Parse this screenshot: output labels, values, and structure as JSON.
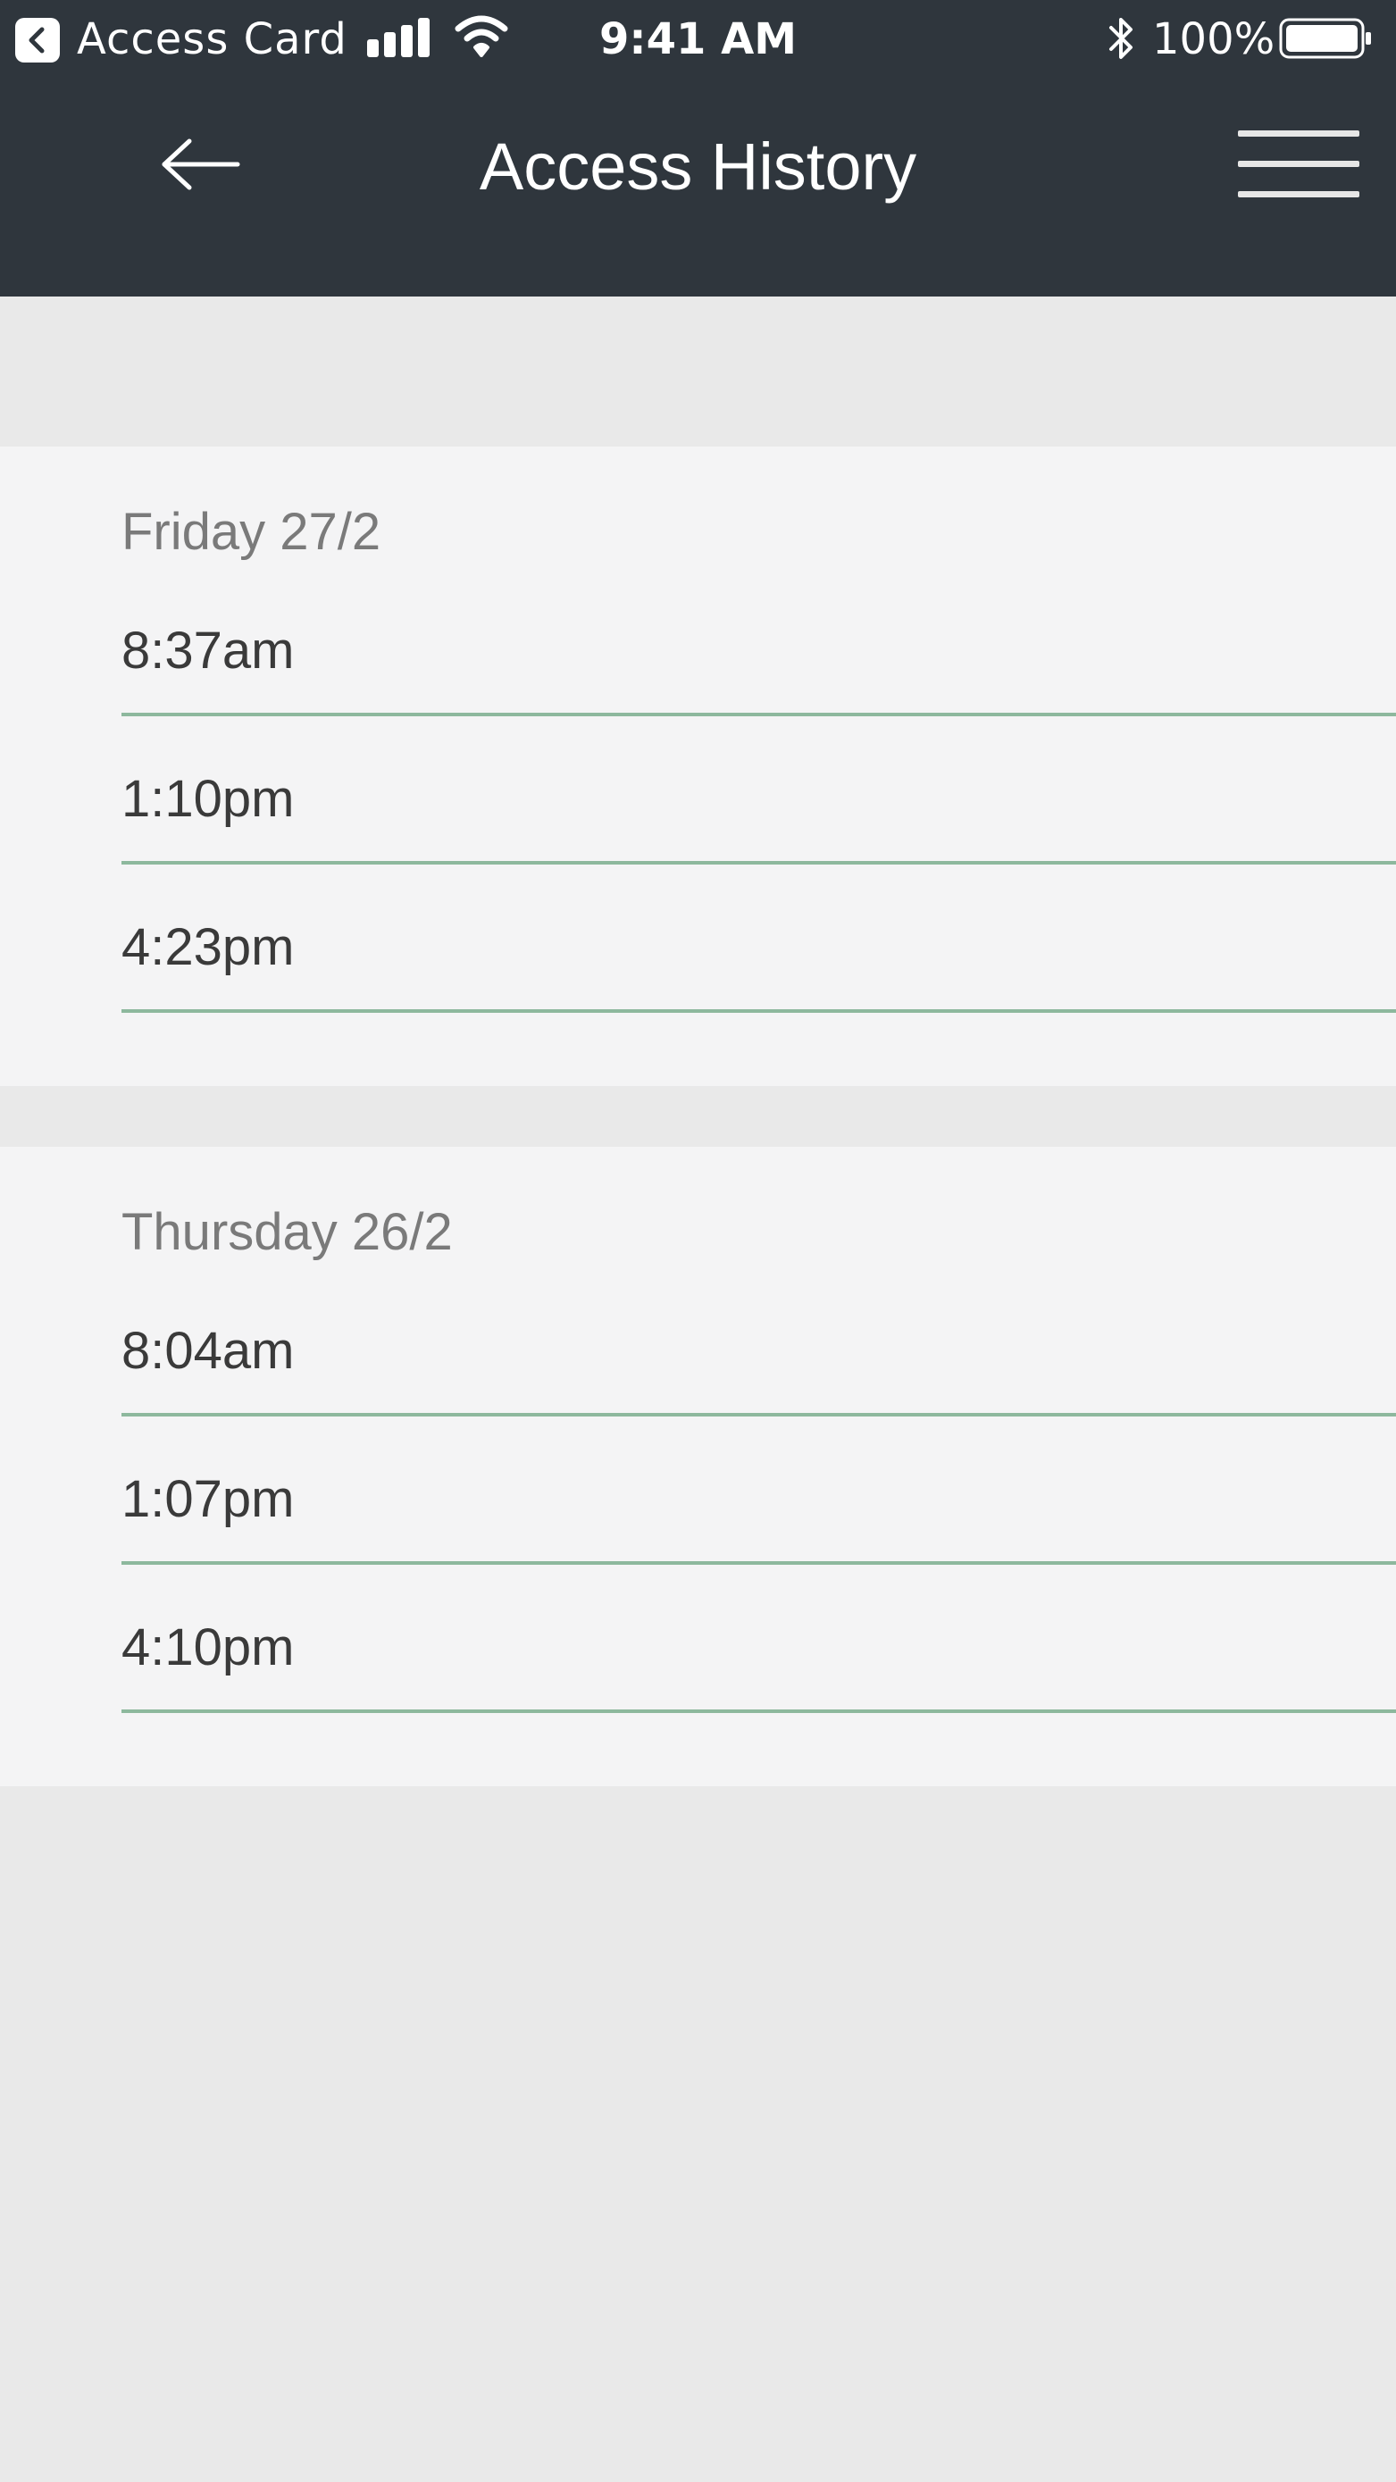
{
  "status_bar": {
    "back_app_label": "Access Card",
    "time": "9:41 AM",
    "battery_percent": "100%",
    "icons": [
      "chevron-left-icon",
      "signal-icon",
      "wifi-icon",
      "bluetooth-icon",
      "battery-icon"
    ]
  },
  "nav": {
    "title": "Access History",
    "icons": [
      "arrow-left-icon",
      "hamburger-menu-icon"
    ]
  },
  "days": [
    {
      "label": "Friday 27/2",
      "times": [
        "8:37am",
        "1:10pm",
        "4:23pm"
      ]
    },
    {
      "label": "Thursday 26/2",
      "times": [
        "8:04am",
        "1:07pm",
        "4:10pm"
      ]
    }
  ],
  "colors": {
    "header_bg": "#2f363d",
    "page_bg": "#e9e9e9",
    "section_bg": "#f4f4f5",
    "divider": "#8db89d"
  }
}
